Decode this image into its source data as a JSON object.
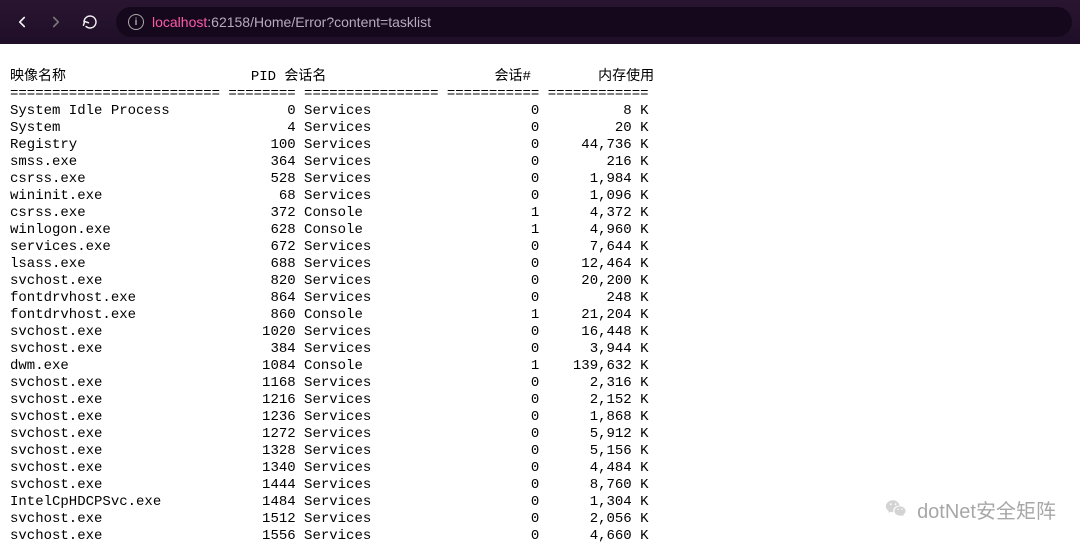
{
  "browser": {
    "url_host": "localhost",
    "url_rest": ":62158/Home/Error?content=tasklist"
  },
  "tasklist": {
    "headers": {
      "image_name": "映像名称",
      "pid": "PID",
      "session_name": "会话名",
      "session_num": "会话#",
      "mem_usage": "内存使用"
    },
    "separator": "========================= ======== ================ =========== ============",
    "rows": [
      {
        "name": "System Idle Process",
        "pid": 0,
        "session": "Services",
        "snum": 0,
        "mem": "8 K"
      },
      {
        "name": "System",
        "pid": 4,
        "session": "Services",
        "snum": 0,
        "mem": "20 K"
      },
      {
        "name": "Registry",
        "pid": 100,
        "session": "Services",
        "snum": 0,
        "mem": "44,736 K"
      },
      {
        "name": "smss.exe",
        "pid": 364,
        "session": "Services",
        "snum": 0,
        "mem": "216 K"
      },
      {
        "name": "csrss.exe",
        "pid": 528,
        "session": "Services",
        "snum": 0,
        "mem": "1,984 K"
      },
      {
        "name": "wininit.exe",
        "pid": 68,
        "session": "Services",
        "snum": 0,
        "mem": "1,096 K"
      },
      {
        "name": "csrss.exe",
        "pid": 372,
        "session": "Console",
        "snum": 1,
        "mem": "4,372 K"
      },
      {
        "name": "winlogon.exe",
        "pid": 628,
        "session": "Console",
        "snum": 1,
        "mem": "4,960 K"
      },
      {
        "name": "services.exe",
        "pid": 672,
        "session": "Services",
        "snum": 0,
        "mem": "7,644 K"
      },
      {
        "name": "lsass.exe",
        "pid": 688,
        "session": "Services",
        "snum": 0,
        "mem": "12,464 K"
      },
      {
        "name": "svchost.exe",
        "pid": 820,
        "session": "Services",
        "snum": 0,
        "mem": "20,200 K"
      },
      {
        "name": "fontdrvhost.exe",
        "pid": 864,
        "session": "Services",
        "snum": 0,
        "mem": "248 K"
      },
      {
        "name": "fontdrvhost.exe",
        "pid": 860,
        "session": "Console",
        "snum": 1,
        "mem": "21,204 K"
      },
      {
        "name": "svchost.exe",
        "pid": 1020,
        "session": "Services",
        "snum": 0,
        "mem": "16,448 K"
      },
      {
        "name": "svchost.exe",
        "pid": 384,
        "session": "Services",
        "snum": 0,
        "mem": "3,944 K"
      },
      {
        "name": "dwm.exe",
        "pid": 1084,
        "session": "Console",
        "snum": 1,
        "mem": "139,632 K"
      },
      {
        "name": "svchost.exe",
        "pid": 1168,
        "session": "Services",
        "snum": 0,
        "mem": "2,316 K"
      },
      {
        "name": "svchost.exe",
        "pid": 1216,
        "session": "Services",
        "snum": 0,
        "mem": "2,152 K"
      },
      {
        "name": "svchost.exe",
        "pid": 1236,
        "session": "Services",
        "snum": 0,
        "mem": "1,868 K"
      },
      {
        "name": "svchost.exe",
        "pid": 1272,
        "session": "Services",
        "snum": 0,
        "mem": "5,912 K"
      },
      {
        "name": "svchost.exe",
        "pid": 1328,
        "session": "Services",
        "snum": 0,
        "mem": "5,156 K"
      },
      {
        "name": "svchost.exe",
        "pid": 1340,
        "session": "Services",
        "snum": 0,
        "mem": "4,484 K"
      },
      {
        "name": "svchost.exe",
        "pid": 1444,
        "session": "Services",
        "snum": 0,
        "mem": "8,760 K"
      },
      {
        "name": "IntelCpHDCPSvc.exe",
        "pid": 1484,
        "session": "Services",
        "snum": 0,
        "mem": "1,304 K"
      },
      {
        "name": "svchost.exe",
        "pid": 1512,
        "session": "Services",
        "snum": 0,
        "mem": "2,056 K"
      },
      {
        "name": "svchost.exe",
        "pid": 1556,
        "session": "Services",
        "snum": 0,
        "mem": "4,660 K"
      }
    ]
  },
  "watermark": "dotNet安全矩阵"
}
